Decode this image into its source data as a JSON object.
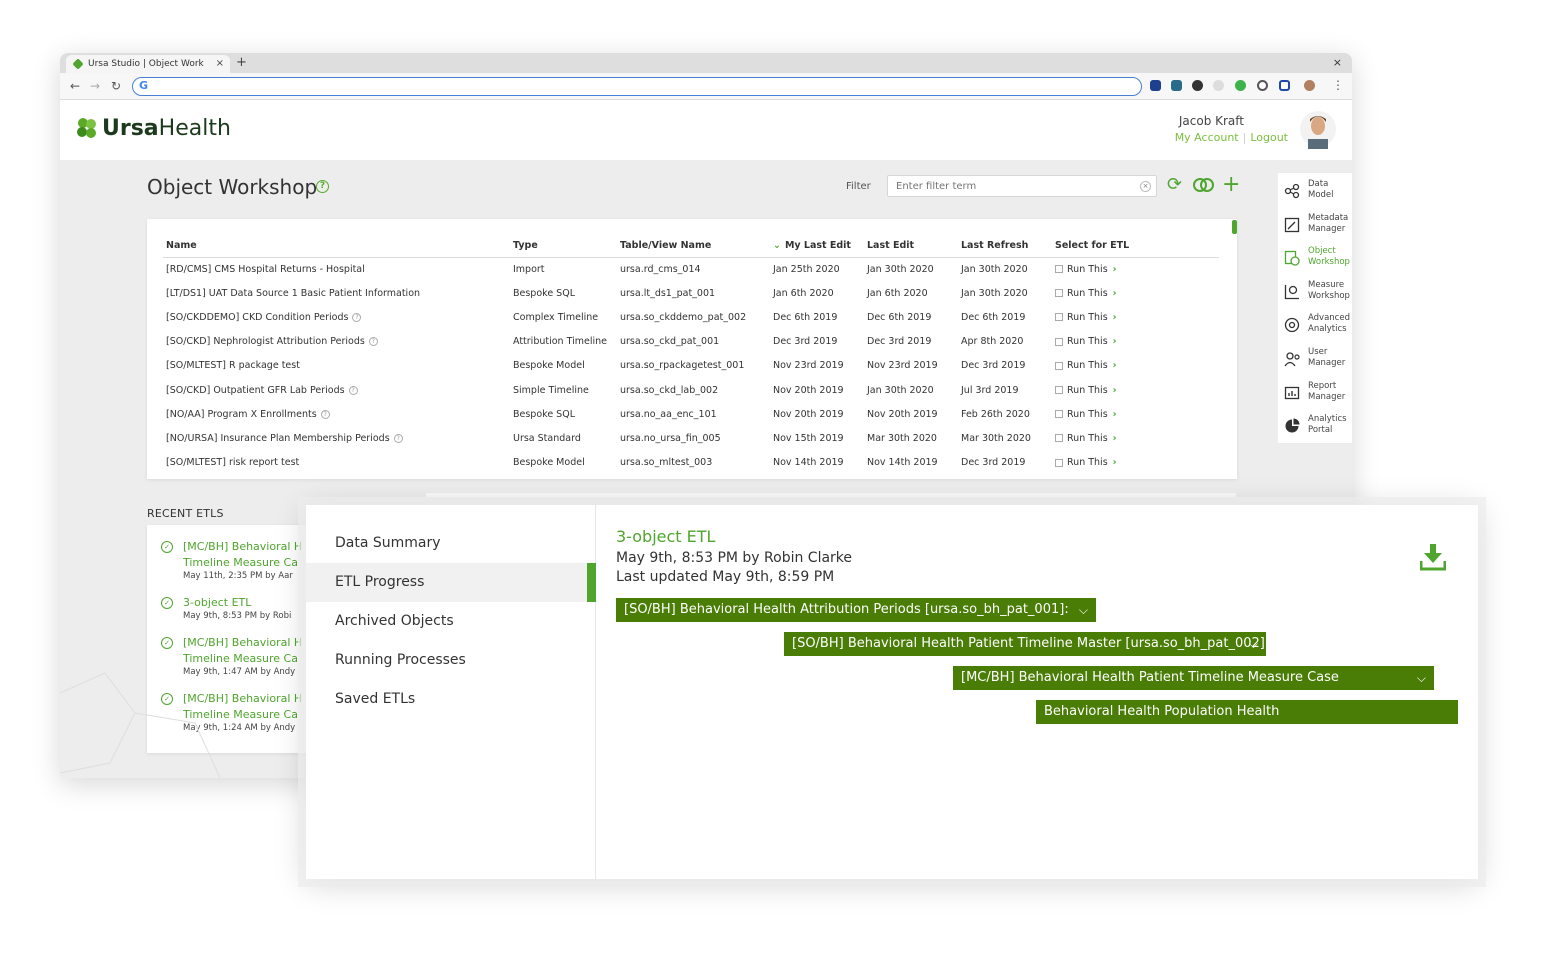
{
  "browser": {
    "tab_title": "Ursa Studio | Object Work",
    "tab_close": "×",
    "new_tab": "+",
    "window_close": "×",
    "omnibox_glyph": "G"
  },
  "header": {
    "logo_bold": "Ursa",
    "logo_light": "Health",
    "user_name": "Jacob Kraft",
    "my_account": "My Account",
    "logout": "Logout",
    "separator": "|"
  },
  "page": {
    "title": "Object Workshop",
    "help": "?",
    "filter_label": "Filter",
    "filter_placeholder": "Enter filter term",
    "filter_clear": "×"
  },
  "table": {
    "columns": [
      "Name",
      "Type",
      "Table/View Name",
      "My Last Edit",
      "Last Edit",
      "Last Refresh",
      "Select for ETL"
    ],
    "run_label": "Run This",
    "rows": [
      {
        "name": "[RD/CMS] CMS Hospital Returns - Hospital",
        "help": false,
        "type": "Import",
        "table": "ursa.rd_cms_014",
        "my_last_edit": "Jan 25th 2020",
        "last_edit": "Jan 30th 2020",
        "last_refresh": "Jan 30th 2020"
      },
      {
        "name": "[LT/DS1] UAT Data Source 1 Basic Patient Information",
        "help": false,
        "type": "Bespoke SQL",
        "table": "ursa.lt_ds1_pat_001",
        "my_last_edit": "Jan 6th 2020",
        "last_edit": "Jan 6th 2020",
        "last_refresh": "Jan 30th 2020"
      },
      {
        "name": "[SO/CKDDEMO] CKD Condition Periods",
        "help": true,
        "type": "Complex Timeline",
        "table": "ursa.so_ckddemo_pat_002",
        "my_last_edit": "Dec 6th 2019",
        "last_edit": "Dec 6th 2019",
        "last_refresh": "Dec 6th 2019"
      },
      {
        "name": "[SO/CKD] Nephrologist Attribution Periods",
        "help": true,
        "type": "Attribution Timeline",
        "table": "ursa.so_ckd_pat_001",
        "my_last_edit": "Dec 3rd 2019",
        "last_edit": "Dec 3rd 2019",
        "last_refresh": "Apr 8th 2020"
      },
      {
        "name": "[SO/MLTEST] R package test",
        "help": false,
        "type": "Bespoke Model",
        "table": "ursa.so_rpackagetest_001",
        "my_last_edit": "Nov 23rd 2019",
        "last_edit": "Nov 23rd 2019",
        "last_refresh": "Dec 3rd 2019"
      },
      {
        "name": "[SO/CKD] Outpatient GFR Lab Periods",
        "help": true,
        "type": "Simple Timeline",
        "table": "ursa.so_ckd_lab_002",
        "my_last_edit": "Nov 20th 2019",
        "last_edit": "Jan 30th 2020",
        "last_refresh": "Jul 3rd 2019"
      },
      {
        "name": "[NO/AA] Program X Enrollments",
        "help": true,
        "type": "Bespoke SQL",
        "table": "ursa.no_aa_enc_101",
        "my_last_edit": "Nov 20th 2019",
        "last_edit": "Nov 20th 2019",
        "last_refresh": "Feb 26th 2020"
      },
      {
        "name": "[NO/URSA] Insurance Plan Membership Periods",
        "help": true,
        "type": "Ursa Standard",
        "table": "ursa.no_ursa_fin_005",
        "my_last_edit": "Nov 15th 2019",
        "last_edit": "Mar 30th 2020",
        "last_refresh": "Mar 30th 2020"
      },
      {
        "name": "[SO/MLTEST] risk report test",
        "help": false,
        "type": "Bespoke Model",
        "table": "ursa.so_mltest_003",
        "my_last_edit": "Nov 14th 2019",
        "last_edit": "Nov 14th 2019",
        "last_refresh": "Dec 3rd 2019"
      }
    ]
  },
  "right_nav": [
    {
      "label": "Data\nModel",
      "icon": "data-model-icon",
      "active": false
    },
    {
      "label": "Metadata\nManager",
      "icon": "metadata-manager-icon",
      "active": false
    },
    {
      "label": "Object\nWorkshop",
      "icon": "object-workshop-icon",
      "active": true
    },
    {
      "label": "Measure\nWorkshop",
      "icon": "measure-workshop-icon",
      "active": false
    },
    {
      "label": "Advanced\nAnalytics",
      "icon": "advanced-analytics-icon",
      "active": false
    },
    {
      "label": "User\nManager",
      "icon": "user-manager-icon",
      "active": false
    },
    {
      "label": "Report\nManager",
      "icon": "report-manager-icon",
      "active": false
    },
    {
      "label": "Analytics\nPortal",
      "icon": "analytics-portal-icon",
      "active": false
    }
  ],
  "recent_etls": {
    "title": "RECENT ETLS",
    "items": [
      {
        "title": "[MC/BH] Behavioral H\nTimeline Measure Ca",
        "meta": "May 11th, 2:35 PM by Aar"
      },
      {
        "title": "3-object ETL",
        "meta": "May 9th, 8:53 PM by Robi"
      },
      {
        "title": "[MC/BH] Behavioral H\nTimeline Measure Ca",
        "meta": "May 9th, 1:47 AM by Andy"
      },
      {
        "title": "[MC/BH] Behavioral H\nTimeline Measure Ca",
        "meta": "May 9th, 1:24 AM by Andy"
      }
    ]
  },
  "etl_panel": {
    "menu": [
      "Data Summary",
      "ETL Progress",
      "Archived Objects",
      "Running Processes",
      "Saved ETLs"
    ],
    "active_menu": "ETL Progress",
    "title": "3-object ETL",
    "created": "May 9th, 8:53 PM by Robin Clarke",
    "updated": "Last updated May 9th, 8:59 PM",
    "bars": [
      {
        "label": "[SO/BH] Behavioral Health Attribution Periods [ursa.so_bh_pat_001]:",
        "expandable": true
      },
      {
        "label": "[SO/BH] Behavioral Health Patient Timeline Master [ursa.so_bh_pat_002]:",
        "expandable": true
      },
      {
        "label": "[MC/BH] Behavioral Health Patient Timeline Measure Case",
        "expandable": true
      },
      {
        "label": "Behavioral Health Population Health",
        "expandable": false
      }
    ]
  },
  "colors": {
    "accent": "#4fa52e",
    "gantt": "#4a7d06",
    "background": "#ededed"
  }
}
